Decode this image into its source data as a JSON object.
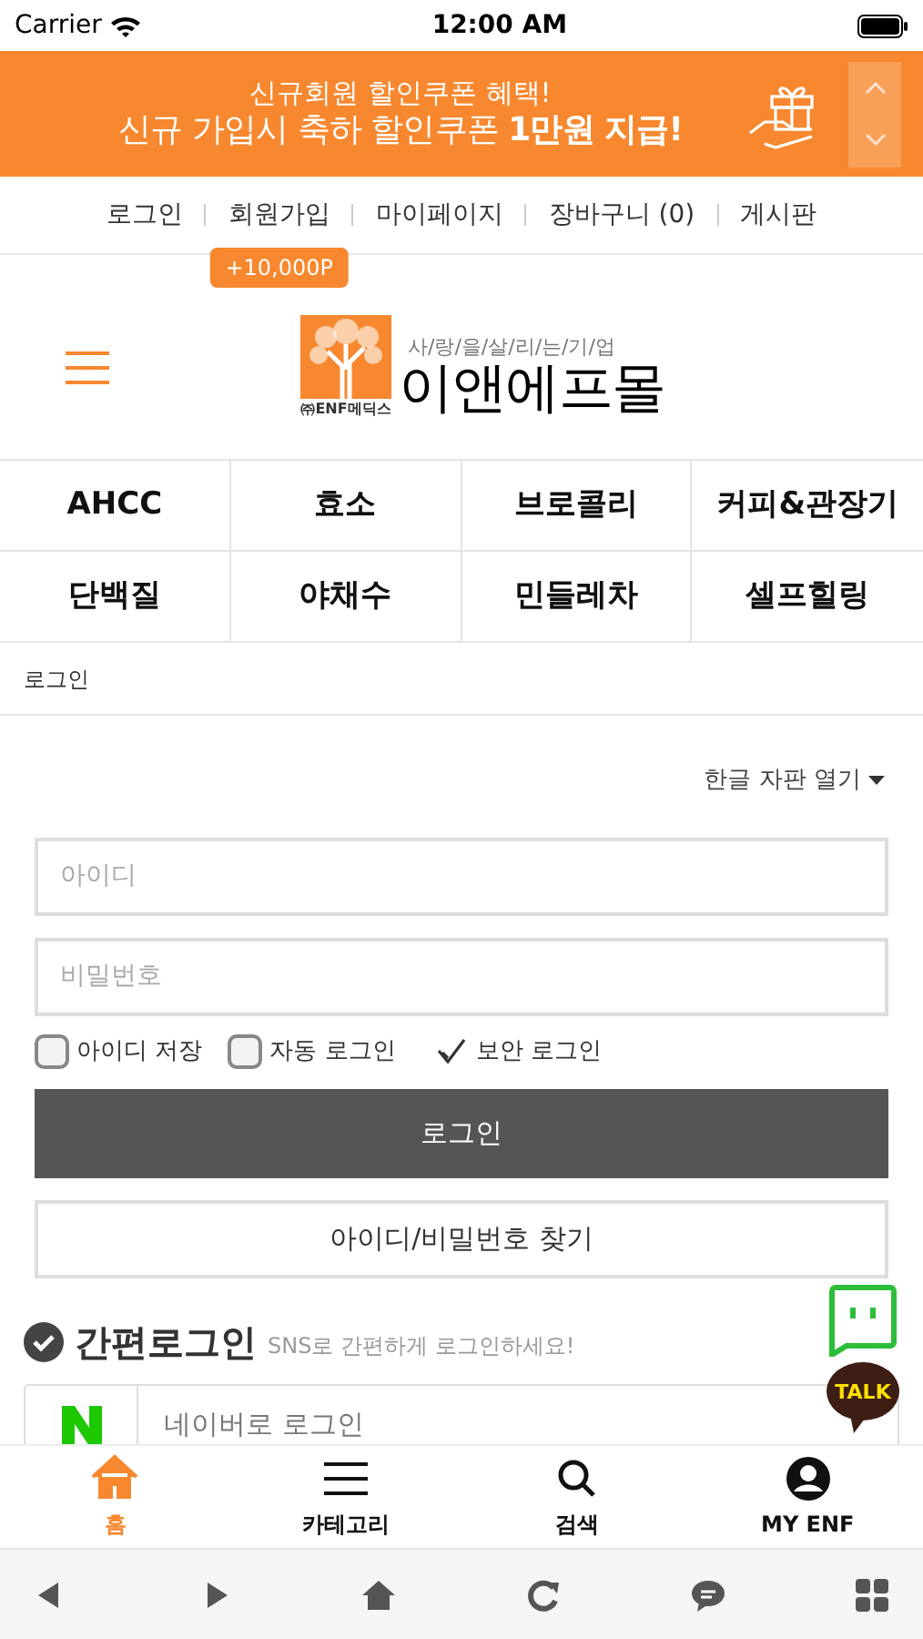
{
  "status_bar": {
    "carrier": "Carrier",
    "time": "12:00 AM"
  },
  "banner": {
    "line_1": "신규회원 할인쿠폰 혜택!",
    "line_2": "신규 가입시 축하 할인쿠폰 **1만원 지급!**"
  },
  "top_links": [
    {
      "label": "로그인"
    },
    {
      "label": "회원가입",
      "badge": "+10,000P"
    },
    {
      "label": "마이페이지"
    },
    {
      "label": "장바구니 (0)"
    },
    {
      "label": "게시판"
    }
  ],
  "logo": {
    "company": "㈜ENF메딕스",
    "slogan": "사/랑/을/살/리/는/기/업",
    "name": "이앤에프몰"
  },
  "categories": [
    "AHCC",
    "효소",
    "브로콜리",
    "커피&관장기",
    "단백질",
    "야채수",
    "민들레차",
    "셀프힐링"
  ],
  "breadcrumb": "로그인",
  "keyboard_toggle": "한글 자판 열기",
  "login_form": {
    "id_placeholder": "아이디",
    "password_placeholder": "비밀번호",
    "options": [
      {
        "kind": "checkbox",
        "label": "아이디 저장",
        "checked": false
      },
      {
        "kind": "checkbox",
        "label": "자동 로그인",
        "checked": false
      },
      {
        "kind": "tick",
        "label": "보안 로그인",
        "checked": true
      }
    ],
    "login_button": "로그인",
    "find_button": "아이디/비밀번호 찾기"
  },
  "easy_login": {
    "title": "간편로그인",
    "subtitle": "SNS로 간편하게 로그인하세요!",
    "providers": [
      {
        "label": "네이버로 로그인"
      }
    ]
  },
  "talk_button": "TALK",
  "tab_bar": [
    {
      "kind": "home",
      "label": "홈",
      "selected": true
    },
    {
      "kind": "menu",
      "label": "카테고리",
      "selected": false
    },
    {
      "kind": "search",
      "label": "검색",
      "selected": false
    },
    {
      "kind": "user",
      "label": "MY ENF",
      "selected": false
    }
  ]
}
